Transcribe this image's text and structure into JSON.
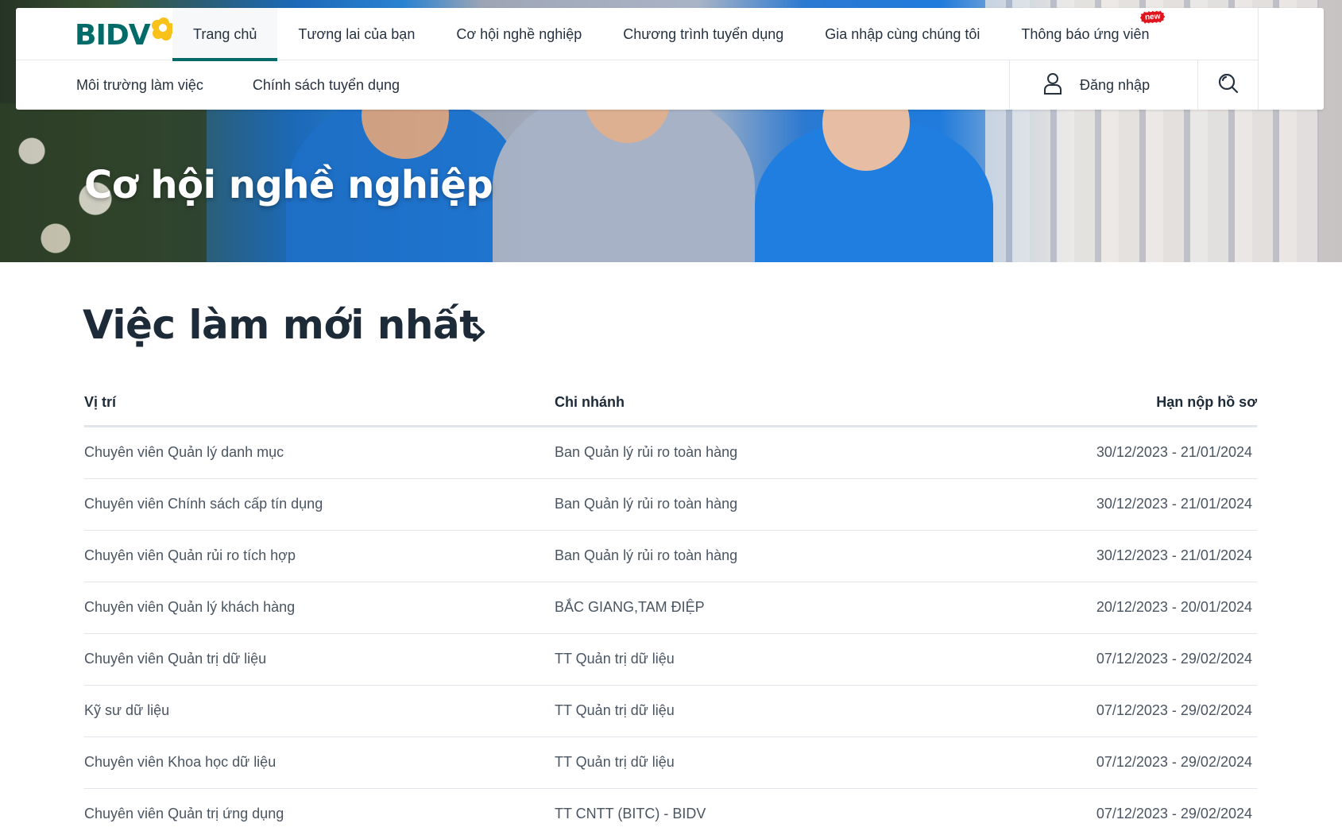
{
  "brand": {
    "logo_text": "BIDV",
    "color": "#006b68",
    "accent": "#f8c21a"
  },
  "nav": {
    "items": [
      {
        "label": "Trang chủ",
        "active": true
      },
      {
        "label": "Tương lai của bạn"
      },
      {
        "label": "Cơ hội nghề nghiệp"
      },
      {
        "label": "Chương trình tuyển dụng"
      },
      {
        "label": "Gia nhập cùng chúng tôi"
      },
      {
        "label": "Thông báo ứng viên",
        "badge": "new"
      }
    ],
    "sub_items": [
      {
        "label": "Môi trường làm việc"
      },
      {
        "label": "Chính sách tuyển dụng"
      }
    ],
    "login_label": "Đăng nhập",
    "login_icon": "user-icon",
    "search_icon": "search-icon"
  },
  "hero": {
    "title": "Cơ hội nghề nghiệp"
  },
  "jobs": {
    "title": "Việc làm mới nhất",
    "title_icon": "chevron-right-icon",
    "headers": {
      "position": "Vị trí",
      "branch": "Chi nhánh",
      "deadline": "Hạn nộp hồ sơ"
    },
    "rows": [
      {
        "position": "Chuyên viên Quản lý danh mục",
        "branch": "Ban Quản lý rủi ro toàn hàng",
        "deadline": "30/12/2023 - 21/01/2024"
      },
      {
        "position": "Chuyên viên Chính sách cấp tín dụng",
        "branch": "Ban Quản lý rủi ro toàn hàng",
        "deadline": "30/12/2023 - 21/01/2024"
      },
      {
        "position": "Chuyên viên Quản rủi ro tích hợp",
        "branch": "Ban Quản lý rủi ro toàn hàng",
        "deadline": "30/12/2023 - 21/01/2024"
      },
      {
        "position": "Chuyên viên Quản lý khách hàng",
        "branch": "BẮC GIANG,TAM ĐIỆP",
        "deadline": "20/12/2023 - 20/01/2024"
      },
      {
        "position": "Chuyên viên Quản trị dữ liệu",
        "branch": "TT Quản trị dữ liệu",
        "deadline": "07/12/2023 - 29/02/2024"
      },
      {
        "position": "Kỹ sư dữ liệu",
        "branch": "TT Quản trị dữ liệu",
        "deadline": "07/12/2023 - 29/02/2024"
      },
      {
        "position": "Chuyên viên Khoa học dữ liệu",
        "branch": "TT Quản trị dữ liệu",
        "deadline": "07/12/2023 - 29/02/2024"
      },
      {
        "position": "Chuyên viên Quản trị ứng dụng",
        "branch": "TT CNTT (BITC) - BIDV",
        "deadline": "07/12/2023 - 29/02/2024"
      }
    ]
  }
}
